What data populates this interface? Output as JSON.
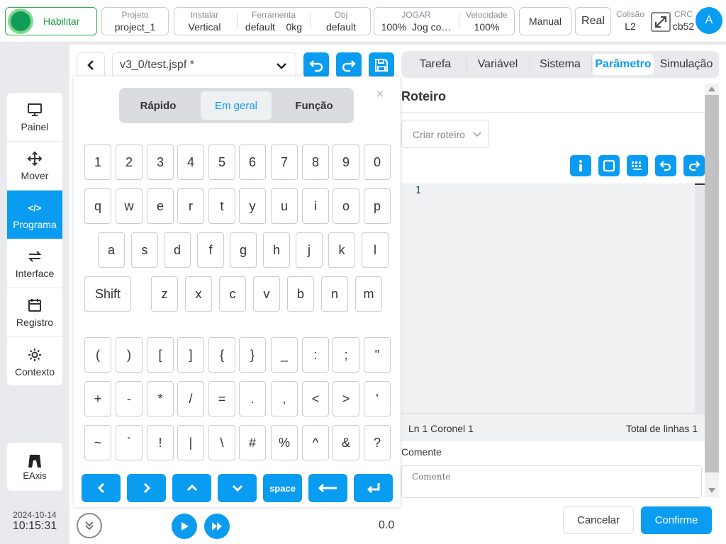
{
  "topbar": {
    "enable_label": "Habilitar",
    "project": {
      "label": "Projeto",
      "value": "project_1"
    },
    "install": {
      "label": "Instalar",
      "value": "Vertical"
    },
    "tool": {
      "label": "Ferramenta",
      "value": "default",
      "weight": "0kg"
    },
    "obj": {
      "label": "Obj",
      "value": "default"
    },
    "jog": {
      "label": "JOGAR",
      "value": "100%",
      "mode": "Jog co…"
    },
    "speed": {
      "label": "Velocidade",
      "value": "100%"
    },
    "manual_label": "Manual",
    "real_label": "Real",
    "collision": {
      "label": "Colisão",
      "value": "L2"
    },
    "crc": {
      "label": "CRC",
      "value": "cb52"
    },
    "avatar_letter": "A"
  },
  "sidebar": {
    "items": [
      {
        "label": "Painel",
        "icon": "monitor-icon"
      },
      {
        "label": "Mover",
        "icon": "move-arrows-icon"
      },
      {
        "label": "Programa",
        "icon": "code-icon"
      },
      {
        "label": "Interface",
        "icon": "swap-icon"
      },
      {
        "label": "Registro",
        "icon": "calendar-icon"
      },
      {
        "label": "Contexto",
        "icon": "gear-icon"
      }
    ],
    "eaxis_label": "EAxis"
  },
  "datetime": {
    "date": "2024-10-14",
    "time": "10:15:31"
  },
  "file": {
    "name": "v3_0/test.jspf *"
  },
  "keyboard": {
    "tabs": [
      "Rápido",
      "Em geral",
      "Função"
    ],
    "active_tab": "Em geral",
    "row1": [
      "1",
      "2",
      "3",
      "4",
      "5",
      "6",
      "7",
      "8",
      "9",
      "0"
    ],
    "row2": [
      "q",
      "w",
      "e",
      "r",
      "t",
      "y",
      "u",
      "i",
      "o",
      "p"
    ],
    "row3": [
      "a",
      "s",
      "d",
      "f",
      "g",
      "h",
      "j",
      "k",
      "l"
    ],
    "row4": [
      "Shift",
      "z",
      "x",
      "c",
      "v",
      "b",
      "n",
      "m"
    ],
    "row5": [
      "(",
      ")",
      "[",
      "]",
      "{",
      "}",
      "_",
      ":",
      ";",
      "\""
    ],
    "row6": [
      "+",
      "-",
      "*",
      "/",
      "=",
      ".",
      ",",
      "<",
      ">",
      "'"
    ],
    "row7": [
      "~",
      "`",
      "!",
      "|",
      "\\",
      "#",
      "%",
      "^",
      "&",
      "?"
    ],
    "space_label": "space",
    "close_glyph": "×"
  },
  "tabs": [
    "Tarefa",
    "Variável",
    "Sistema",
    "Parâmetro",
    "Simulação"
  ],
  "active_tab": "Parâmetro",
  "script": {
    "title": "Roteiro",
    "select_placeholder": "Criar roteiro",
    "line_number": "1",
    "status_position": "Ln 1 Coronel 1",
    "status_total": "Total de linhas 1",
    "comment_label": "Comente",
    "comment_placeholder": "Comente"
  },
  "footer": {
    "cancel_label": "Cancelar",
    "confirm_label": "Confirme",
    "speed_value": "0.0"
  },
  "colors": {
    "accent": "#0a9cf0",
    "enable_green": "#0f9d58"
  }
}
